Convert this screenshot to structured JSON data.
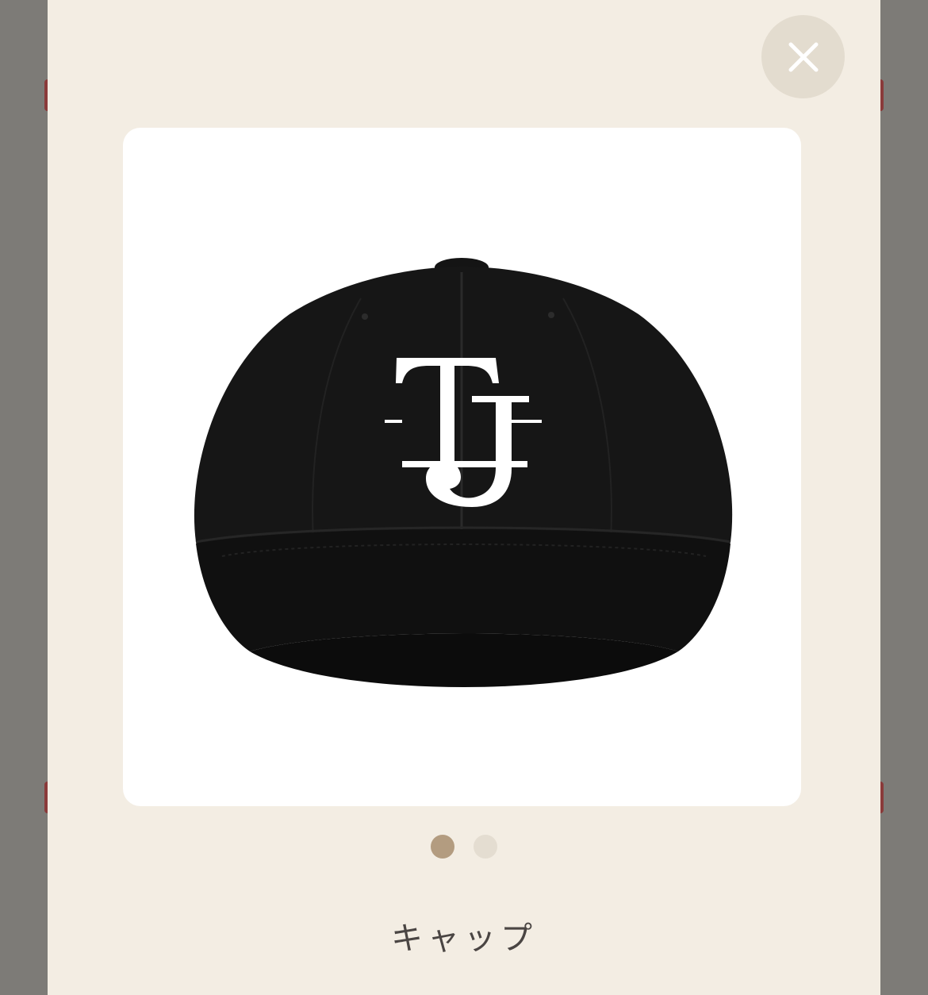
{
  "modal": {
    "close_icon": "close-icon",
    "product_image_alt": "",
    "carousel": {
      "total": 2,
      "active_index": 0,
      "active_color": "#b39c80",
      "inactive_color": "#e4ddd1"
    },
    "product_name": "キャップ"
  },
  "colors": {
    "modal_background": "#f3ede3",
    "close_button_bg": "#e3dccf",
    "backdrop": "#7d7b77"
  }
}
